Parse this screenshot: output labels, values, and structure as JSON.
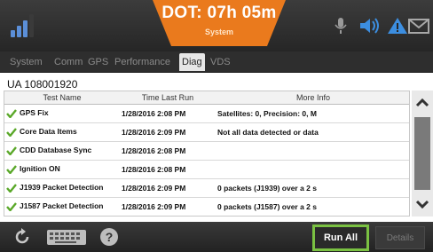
{
  "status_bar": {
    "dot_time": "DOT: 07h 05m",
    "dot_status": "System",
    "icons": [
      "signal-strength-icon",
      "microphone-icon",
      "speaker-icon",
      "warning-icon",
      "mail-icon"
    ]
  },
  "tabs": [
    {
      "label": "System",
      "active": false
    },
    {
      "label": "Comm",
      "active": false
    },
    {
      "label": "GPS",
      "active": false
    },
    {
      "label": "Performance",
      "active": false
    },
    {
      "label": "Diag",
      "active": true
    },
    {
      "label": "VDS",
      "active": false
    }
  ],
  "unit_label": "UA 108001920",
  "table": {
    "headers": [
      "Test Name",
      "Time Last Run",
      "More Info"
    ],
    "rows": [
      {
        "name": "GPS Fix",
        "time": "1/28/2016 2:08 PM",
        "info": "Satellites: 0, Precision: 0, M"
      },
      {
        "name": "Core Data Items",
        "time": "1/28/2016 2:09 PM",
        "info": "Not all data detected or data"
      },
      {
        "name": "CDD Database Sync",
        "time": "1/28/2016 2:08 PM",
        "info": ""
      },
      {
        "name": "Ignition ON",
        "time": "1/28/2016 2:08 PM",
        "info": ""
      },
      {
        "name": "J1939 Packet Detection",
        "time": "1/28/2016 2:09 PM",
        "info": "0 packets (J1939) over a 2 s"
      },
      {
        "name": "J1587 Packet Detection",
        "time": "1/28/2016 2:09 PM",
        "info": "0 packets (J1587) over a 2 s"
      }
    ]
  },
  "buttons": {
    "run_all": "Run All",
    "details": "Details"
  },
  "colors": {
    "accent_orange": "#ea7a1d",
    "highlight_green": "#7ac142",
    "check_green": "#5aa829",
    "icon_blue": "#3c8ee0"
  }
}
